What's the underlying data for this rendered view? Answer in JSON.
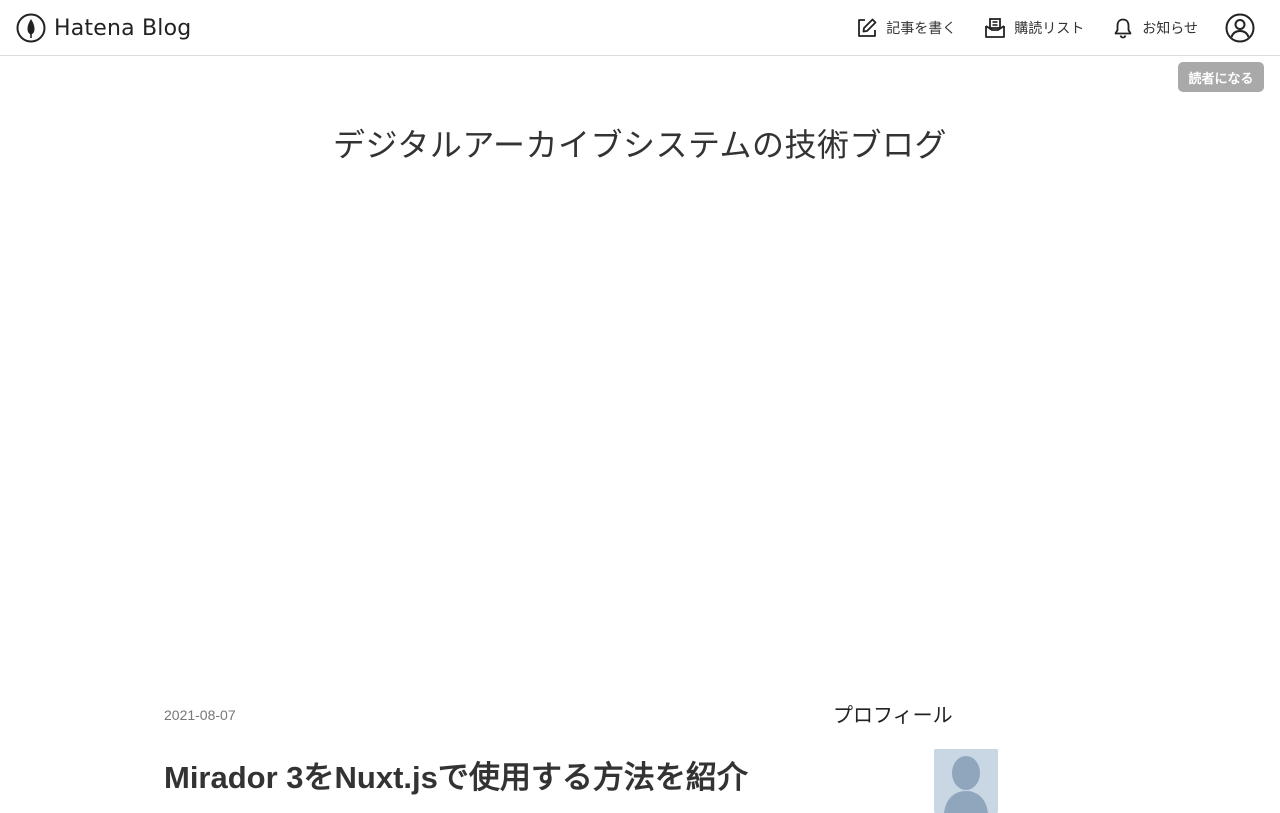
{
  "header": {
    "brand": "Hatena Blog",
    "nav": {
      "write": "記事を書く",
      "reading_list": "購読リスト",
      "notifications": "お知らせ"
    }
  },
  "subscribe_label": "読者になる",
  "blog": {
    "title": "デジタルアーカイブシステムの技術ブログ"
  },
  "entry": {
    "date": "2021-08-07",
    "title": "Mirador 3をNuxt.jsで使用する方法を紹介"
  },
  "sidebar": {
    "profile_heading": "プロフィール"
  },
  "colors": {
    "subscribe_bg": "#a9a9a9",
    "header_border": "#dcdcdc",
    "avatar_bg": "#c9d6e3"
  }
}
